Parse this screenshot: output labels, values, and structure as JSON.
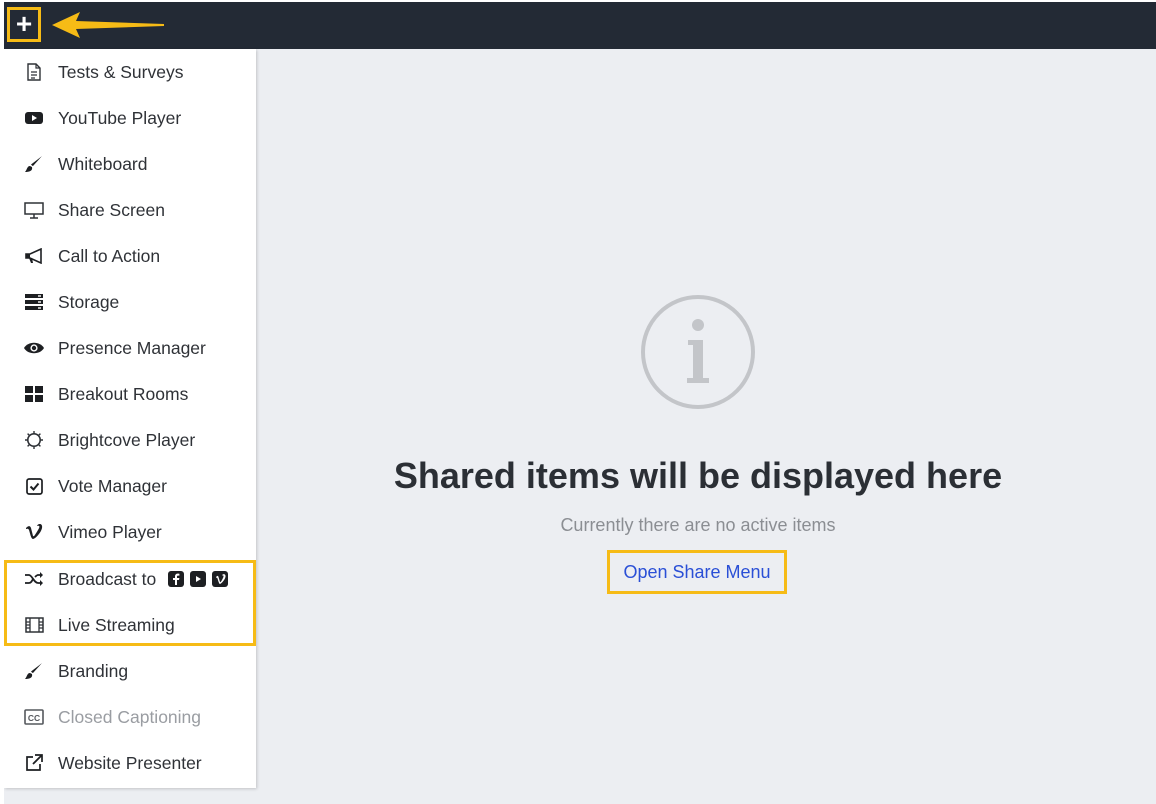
{
  "topbar": {
    "add_label": "+"
  },
  "menu": {
    "items": [
      {
        "label": "Tests & Surveys",
        "icon": "document-icon"
      },
      {
        "label": "YouTube Player",
        "icon": "youtube-icon"
      },
      {
        "label": "Whiteboard",
        "icon": "paintbrush-icon"
      },
      {
        "label": "Share Screen",
        "icon": "monitor-icon"
      },
      {
        "label": "Call to Action",
        "icon": "megaphone-icon"
      },
      {
        "label": "Storage",
        "icon": "server-icon"
      },
      {
        "label": "Presence Manager",
        "icon": "eye-icon"
      },
      {
        "label": "Breakout Rooms",
        "icon": "grid-icon"
      },
      {
        "label": "Brightcove Player",
        "icon": "brightcove-icon"
      },
      {
        "label": "Vote Manager",
        "icon": "checkbox-icon"
      },
      {
        "label": "Vimeo Player",
        "icon": "vimeo-icon"
      },
      {
        "label": "Broadcast to",
        "icon": "shuffle-icon"
      },
      {
        "label": "Live Streaming",
        "icon": "film-icon"
      },
      {
        "label": "Branding",
        "icon": "paintbrush-icon"
      },
      {
        "label": "Closed Captioning",
        "icon": "closed-captions-icon",
        "disabled": true
      },
      {
        "label": "Website Presenter",
        "icon": "external-link-icon"
      }
    ],
    "broadcast_targets": [
      "facebook-icon",
      "youtube-icon",
      "vimeo-icon"
    ]
  },
  "empty_state": {
    "icon": "info-icon",
    "title": "Shared items will be displayed here",
    "subtitle": "Currently there are no active items",
    "button_label": "Open Share Menu"
  },
  "colors": {
    "topbar": "#232a35",
    "highlight": "#f6bb16",
    "content_bg": "#eceef2",
    "link": "#2a4fd6"
  }
}
